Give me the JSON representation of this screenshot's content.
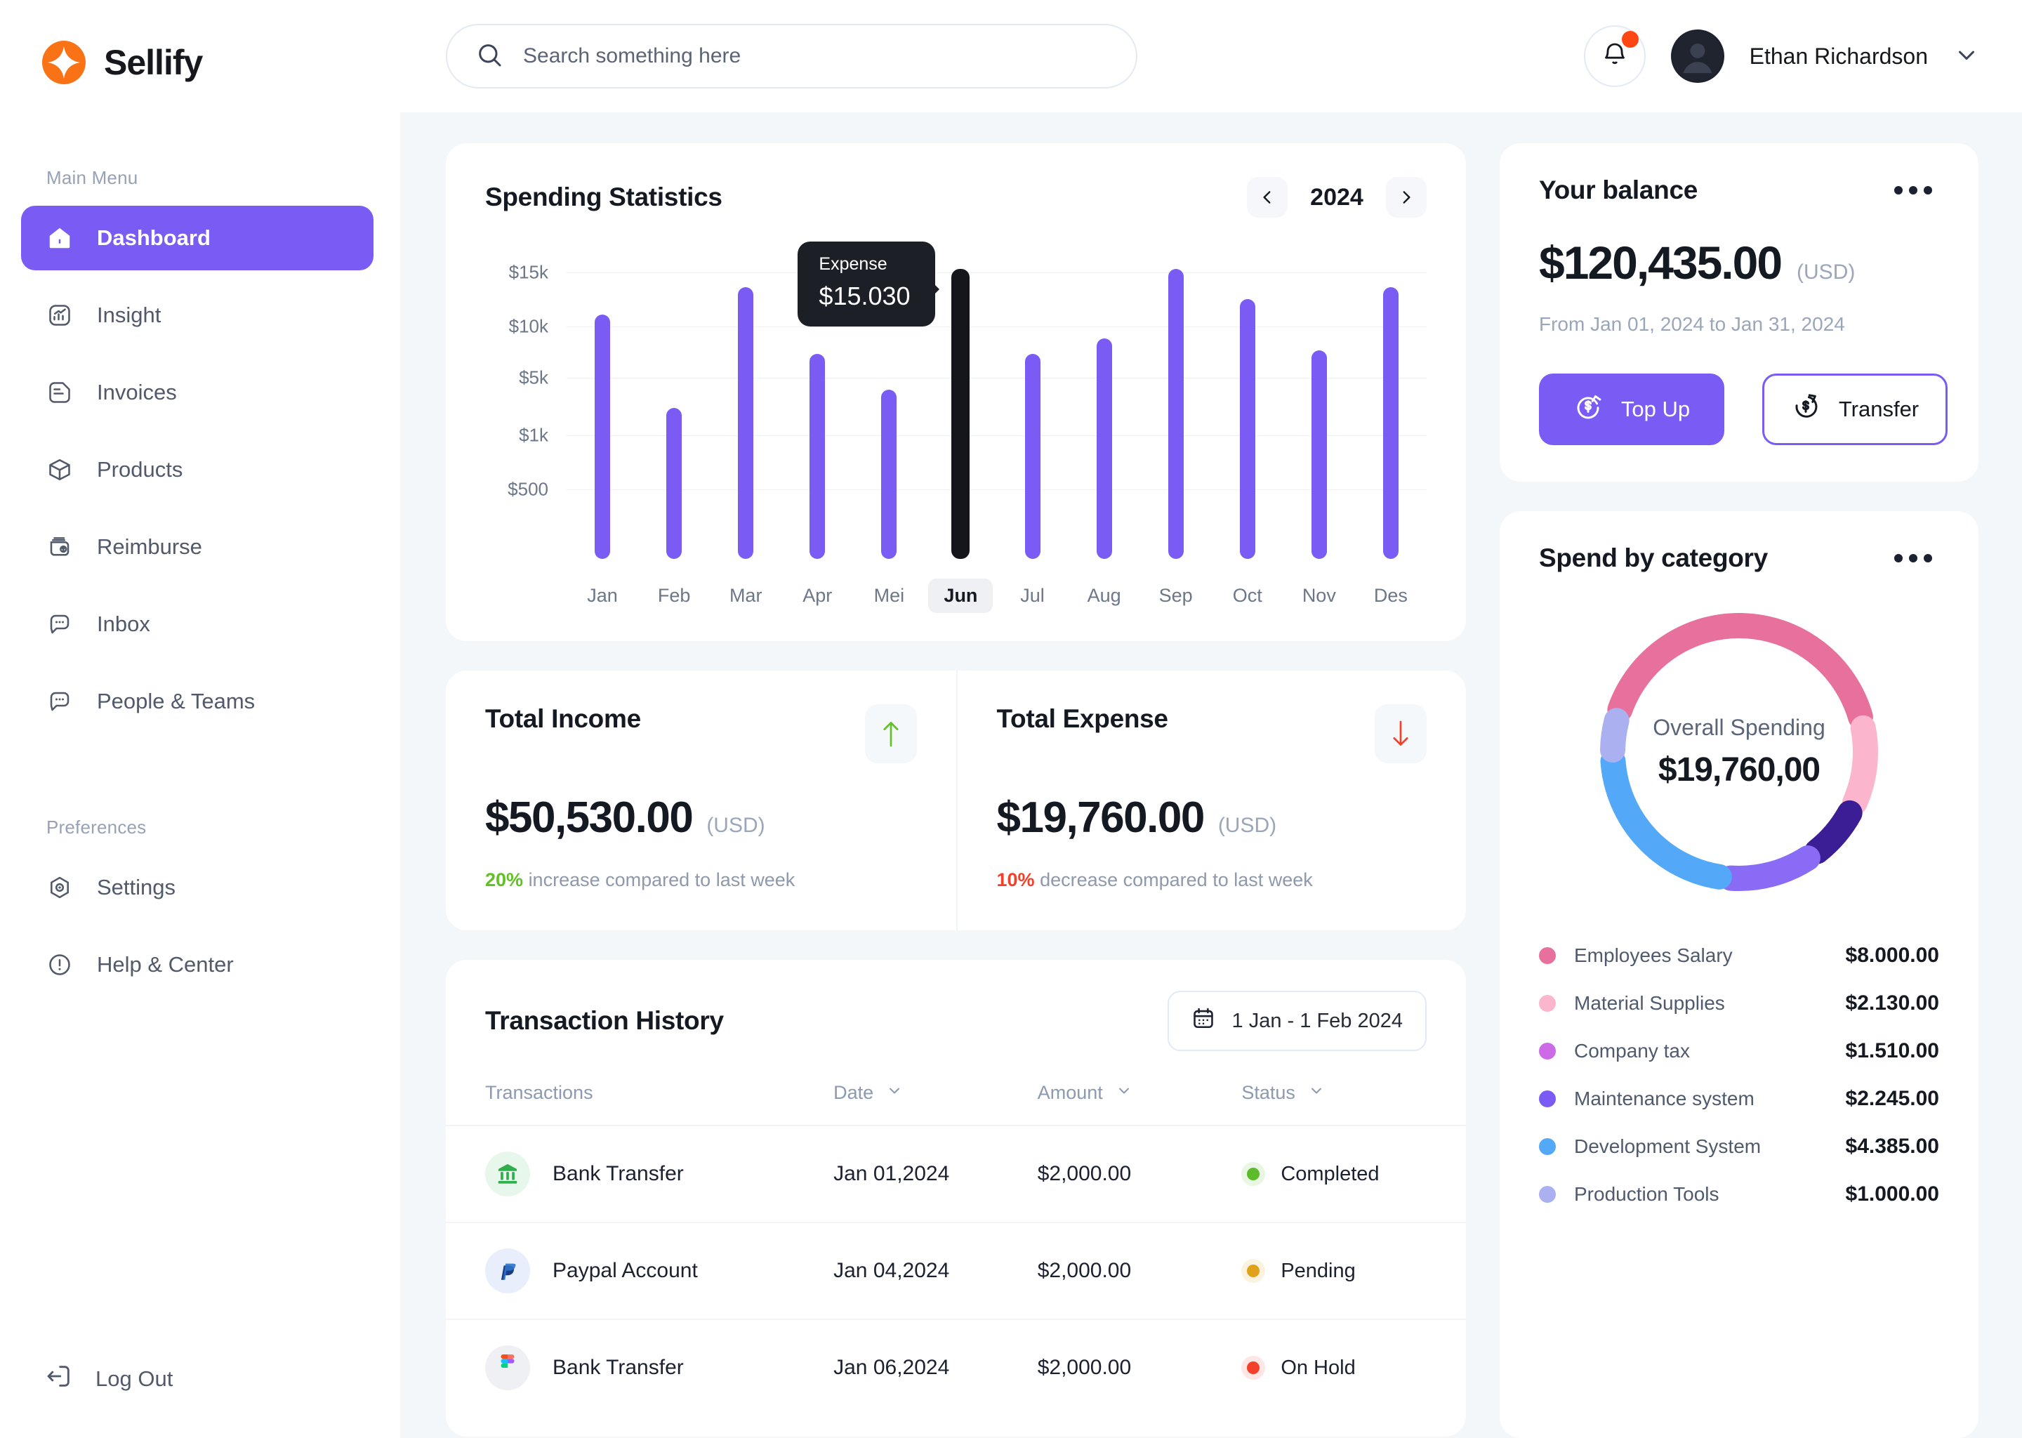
{
  "brand": {
    "name": "Sellify",
    "logo_color": "#f97316"
  },
  "sidebar": {
    "section_main": "Main Menu",
    "section_prefs": "Preferences",
    "items": [
      {
        "label": "Dashboard",
        "icon": "home-icon",
        "active": true
      },
      {
        "label": "Insight",
        "icon": "chart-icon",
        "active": false
      },
      {
        "label": "Invoices",
        "icon": "document-icon",
        "active": false
      },
      {
        "label": "Products",
        "icon": "box-icon",
        "active": false
      },
      {
        "label": "Reimburse",
        "icon": "money-back-icon",
        "active": false
      },
      {
        "label": "Inbox",
        "icon": "chat-icon",
        "active": false
      },
      {
        "label": "People & Teams",
        "icon": "chat-icon",
        "active": false
      }
    ],
    "pref_items": [
      {
        "label": "Settings",
        "icon": "gear-icon"
      },
      {
        "label": "Help & Center",
        "icon": "info-circle-icon"
      }
    ],
    "logout": {
      "label": "Log Out",
      "icon": "logout-icon"
    }
  },
  "topbar": {
    "search_placeholder": "Search something here",
    "user_name": "Ethan Richardson",
    "notification_badge": true
  },
  "spending": {
    "title": "Spending Statistics",
    "year": "2024",
    "tooltip_label": "Expense",
    "tooltip_value": "$15.030",
    "selected_month": "Jun"
  },
  "chart_data": [
    {
      "type": "bar",
      "title": "Spending Statistics",
      "categories": [
        "Jan",
        "Feb",
        "Mar",
        "Apr",
        "Mei",
        "Jun",
        "Jul",
        "Aug",
        "Sep",
        "Oct",
        "Nov",
        "Des"
      ],
      "values": [
        11000,
        2500,
        13500,
        7000,
        4500,
        15030,
        7000,
        8500,
        15100,
        12200,
        6900,
        13400
      ],
      "ytick_labels": [
        "$15k",
        "$10k",
        "$5k",
        "$1k",
        "$500"
      ],
      "ytick_positions_pct": [
        5,
        23,
        40,
        59,
        77
      ],
      "bar_tops_pct": [
        19,
        50,
        10,
        32,
        44,
        4,
        32,
        27,
        4,
        14,
        31,
        10
      ],
      "highlight_index": 5,
      "highlight_color": "#14161c",
      "bar_color": "#7a5cf5",
      "xlabel": "",
      "ylabel": "",
      "grid": true,
      "legend": "none"
    },
    {
      "type": "pie",
      "title": "Spend by category",
      "center_label": "Overall Spending",
      "center_value": "$19,760,00",
      "categories": [
        "Employees Salary",
        "Material Supplies",
        "Company tax",
        "Maintenance system",
        "Development System",
        "Production Tools"
      ],
      "values": [
        8000.0,
        2130.0,
        1510.0,
        2245.0,
        4385.0,
        1000.0
      ],
      "value_labels": [
        "$8.000.00",
        "$2.130.00",
        "$1.510.00",
        "$2.245.00",
        "$4.385.00",
        "$1.000.00"
      ],
      "legend_colors": [
        "#e8709c",
        "#fbb6ce",
        "#cc6ae8",
        "#7a5cf5",
        "#53a8f8",
        "#aab0f0"
      ],
      "slice_colors": [
        "#e8709c",
        "#fbb6ce",
        "#3b1d96",
        "#8a6bf6",
        "#53a8f8",
        "#aab0f0"
      ],
      "legend": "bottom"
    }
  ],
  "balance": {
    "title": "Your balance",
    "amount": "$120,435.00",
    "currency": "(USD)",
    "range": "From Jan 01, 2024 to Jan 31, 2024",
    "topup_label": "Top Up",
    "transfer_label": "Transfer"
  },
  "stats": {
    "income": {
      "label": "Total Income",
      "value": "$50,530.00",
      "currency": "(USD)",
      "delta": "20%",
      "note": "increase compared to last week",
      "direction": "up",
      "color": "#62c127"
    },
    "expense": {
      "label": "Total Expense",
      "value": "$19,760.00",
      "currency": "(USD)",
      "delta": "10%",
      "note": "decrease compared to last week",
      "direction": "down",
      "color": "#f2402a"
    }
  },
  "transactions": {
    "title": "Transaction History",
    "date_range": "1 Jan - 1 Feb 2024",
    "columns": [
      "Transactions",
      "Date",
      "Amount",
      "Status"
    ],
    "rows": [
      {
        "name": "Bank Transfer",
        "icon": "bank-icon",
        "date": "Jan 01,2024",
        "amount": "$2,000.00",
        "status": "Completed",
        "status_color": "#5cbb2a"
      },
      {
        "name": "Paypal Account",
        "icon": "paypal-icon",
        "date": "Jan 04,2024",
        "amount": "$2,000.00",
        "status": "Pending",
        "status_color": "#e0a21a"
      },
      {
        "name": "Bank Transfer",
        "icon": "figma-icon",
        "date": "Jan 06,2024",
        "amount": "$2,000.00",
        "status": "On Hold",
        "status_color": "#f2402a"
      }
    ]
  },
  "category": {
    "title": "Spend by category"
  }
}
